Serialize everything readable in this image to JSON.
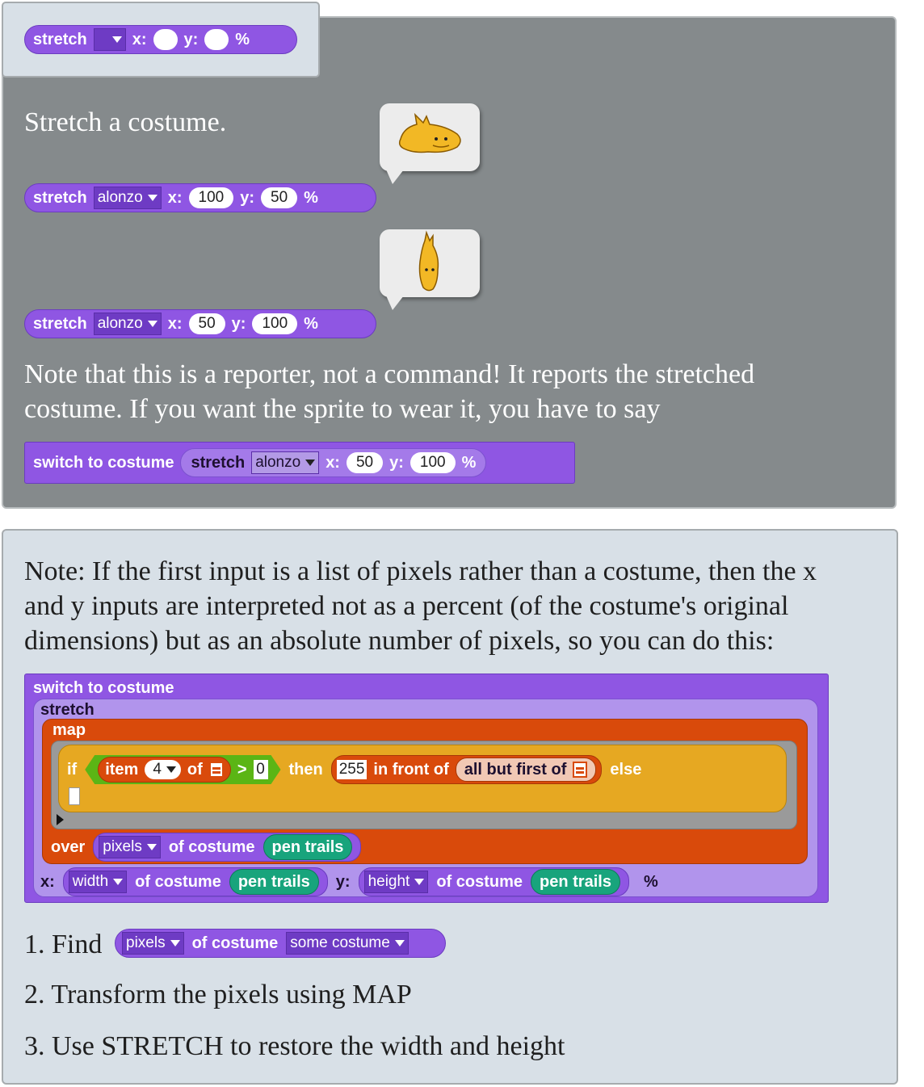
{
  "header_block": {
    "verb": "stretch",
    "x_label": "x:",
    "y_label": "y:",
    "pct": "%"
  },
  "intro": "Stretch a costume.",
  "example1": {
    "verb": "stretch",
    "costume": "alonzo",
    "x_label": "x:",
    "x": "100",
    "y_label": "y:",
    "y": "50",
    "pct": "%"
  },
  "example2": {
    "verb": "stretch",
    "costume": "alonzo",
    "x_label": "x:",
    "x": "50",
    "y_label": "y:",
    "y": "100",
    "pct": "%"
  },
  "note1_line1": "Note that this is a reporter, not a command! It reports the stretched",
  "note1_line2": "costume. If you want the sprite to wear it, you have to say",
  "switch_example": {
    "cmd": "switch to costume",
    "verb": "stretch",
    "costume": "alonzo",
    "x_label": "x:",
    "x": "50",
    "y_label": "y:",
    "y": "100",
    "pct": "%"
  },
  "note2_line1": "Note: If the first input is a list of pixels rather than a costume, then the x",
  "note2_line2": "and y inputs are interpreted not as a percent (of the costume's original",
  "note2_line3": "dimensions) but as an absolute number of pixels, so you can do this:",
  "big_script": {
    "switch": "switch to costume",
    "stretch": "stretch",
    "map": "map",
    "if": "if",
    "item": "item",
    "item_index": "4",
    "of": "of",
    "gt": ">",
    "zero": "0",
    "then": "then",
    "val255": "255",
    "in_front_of": "in front of",
    "all_but_first_of": "all but first of",
    "else": "else",
    "over": "over",
    "pixels": "pixels",
    "of_costume": "of costume",
    "pen_trails": "pen trails",
    "x_label": "x:",
    "width": "width",
    "y_label": "y:",
    "height": "height",
    "pct": "%"
  },
  "step1_prefix": "1. Find",
  "step1_block": {
    "attr": "pixels",
    "of_costume": "of costume",
    "costume": "some costume"
  },
  "step2": "2. Transform the pixels using MAP",
  "step3": "3. Use STRETCH to restore the width and height",
  "colors": {
    "looks": "#8f56e3",
    "lists": "#d94a0b",
    "control": "#e6a822",
    "operators": "#5bb515",
    "pen": "#18a47c"
  }
}
